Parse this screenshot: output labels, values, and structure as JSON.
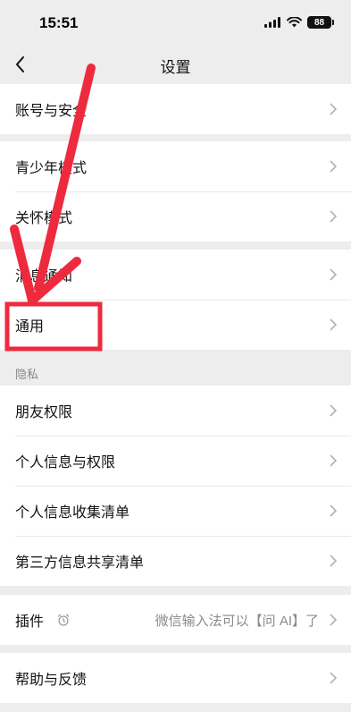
{
  "status_bar": {
    "time": "15:51",
    "battery": "88"
  },
  "nav": {
    "title": "设置"
  },
  "groups": {
    "account": [
      "账号与安全"
    ],
    "modes": [
      "青少年模式",
      "关怀模式"
    ],
    "general": [
      "消息通知",
      "通用"
    ],
    "privacy_label": "隐私",
    "privacy": [
      "朋友权限",
      "个人信息与权限",
      "个人信息收集清单",
      "第三方信息共享清单"
    ],
    "plugins": {
      "label": "插件",
      "hint": "微信输入法可以【问 AI】了"
    },
    "help": [
      "帮助与反馈"
    ]
  },
  "colors": {
    "annotation_red": "#ee2a3e",
    "background": "#ededed",
    "row_bg": "#ffffff"
  }
}
